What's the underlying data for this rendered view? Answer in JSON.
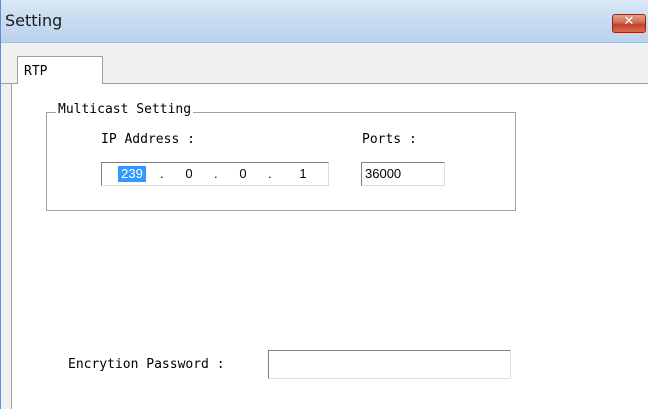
{
  "window": {
    "title": "Setting",
    "close_icon": "close-icon"
  },
  "tabs": [
    {
      "label": "RTP",
      "selected": true
    }
  ],
  "multicast": {
    "group_label": "Multicast Setting",
    "ip_label": "IP Address :",
    "ip_octets": [
      "239",
      "0",
      "0",
      "1"
    ],
    "ip_separator": ".",
    "ports_label": "Ports :",
    "ports_value": "36000"
  },
  "encryption": {
    "label": "Encrytion Password :",
    "value": ""
  },
  "colors": {
    "selection": "#3399ff",
    "close_button": "#c0432a",
    "titlebar": "#c9dcf1"
  }
}
